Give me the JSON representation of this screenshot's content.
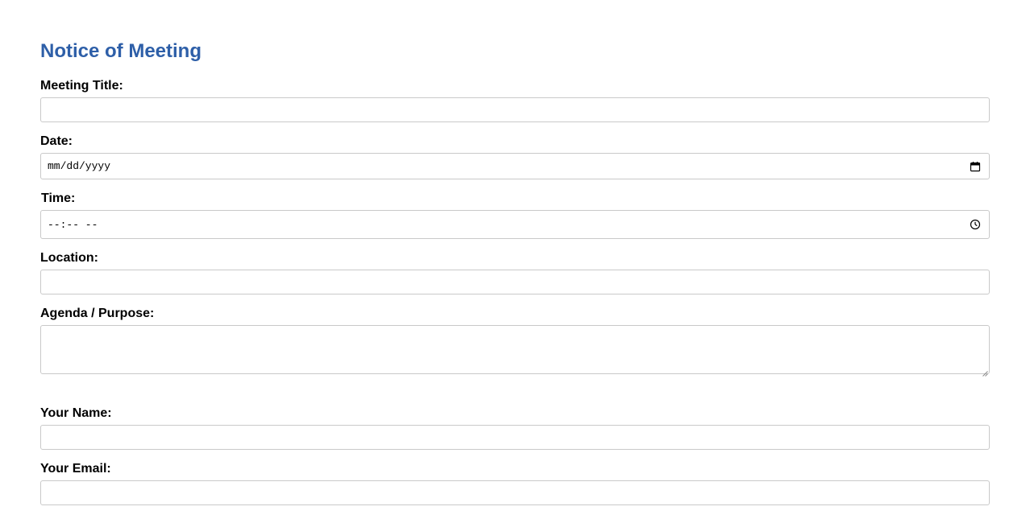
{
  "form": {
    "title": "Notice of Meeting",
    "fields": {
      "meeting_title": {
        "label": "Meeting Title:",
        "value": ""
      },
      "date": {
        "label": "Date:",
        "placeholder": "mm/dd/yyyy",
        "icon": "calendar-icon"
      },
      "time": {
        "label": "Time:",
        "placeholder": "--:-- --",
        "icon": "clock-icon"
      },
      "location": {
        "label": "Location:",
        "value": ""
      },
      "agenda": {
        "label": "Agenda / Purpose:",
        "value": ""
      },
      "your_name": {
        "label": "Your Name:",
        "value": ""
      },
      "your_email": {
        "label": "Your Email:",
        "value": ""
      }
    }
  },
  "colors": {
    "title": "#2e5fa8",
    "border": "#c9c9c9"
  }
}
